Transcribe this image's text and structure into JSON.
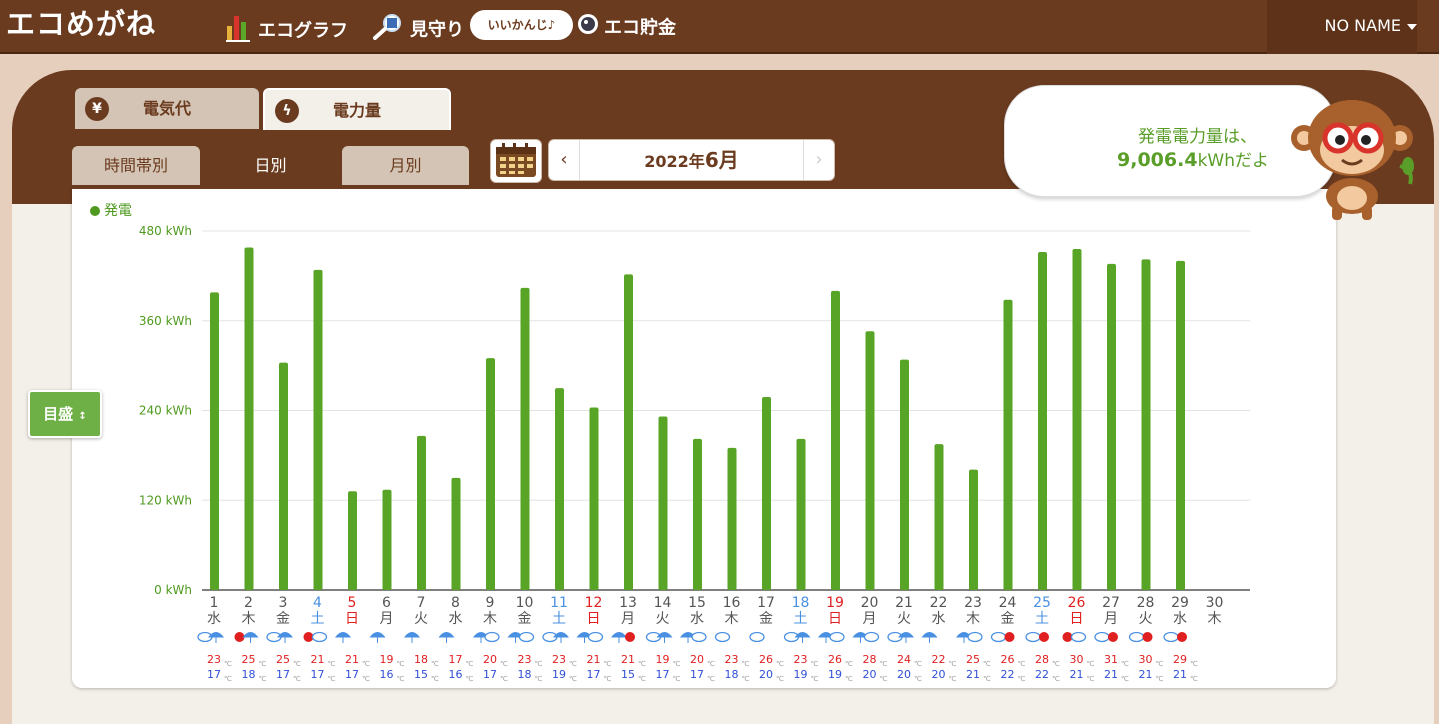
{
  "header": {
    "logo": "エコめがね",
    "nav": [
      {
        "label": "エコグラフ",
        "icon": "bar-chart-icon"
      },
      {
        "label": "見守り",
        "icon": "magnifier-icon"
      },
      {
        "label": "エコ貯金",
        "icon": "coin-icon"
      }
    ],
    "pill": "いいかんじ♪",
    "user": "NO NAME"
  },
  "tabs": {
    "main": [
      {
        "label": "電気代",
        "icon": "yen-icon"
      },
      {
        "label": "電力量",
        "icon": "lightning-icon"
      }
    ],
    "sub": [
      "時間帯別",
      "日別",
      "月別"
    ],
    "active_main": "電力量",
    "active_sub": "日別"
  },
  "date": {
    "year": "2022年",
    "month": "6月"
  },
  "bubble": {
    "line1": "発電電力量は、",
    "value": "9,006.4",
    "unit": "kWhだよ"
  },
  "scale_button": "目盛",
  "colors": {
    "bar": "#58a426",
    "weekday": "#555555",
    "saturday": "#4a90e2",
    "sunday": "#e02020",
    "max_temp": "#e02020",
    "min_temp": "#2f4fd8"
  },
  "chart_data": {
    "type": "bar",
    "legend": "発電",
    "ylim": [
      0,
      480
    ],
    "yticks": [
      "0 kWh",
      "120 kWh",
      "240 kWh",
      "360 kWh",
      "480 kWh"
    ],
    "series": [
      {
        "name": "発電",
        "values": [
          398,
          458,
          304,
          428,
          132,
          134,
          206,
          150,
          310,
          404,
          270,
          244,
          422,
          232,
          202,
          190,
          258,
          202,
          400,
          346,
          308,
          195,
          161,
          388,
          452,
          456,
          436,
          442,
          440,
          null
        ]
      }
    ],
    "days": [
      {
        "d": "1",
        "w": "水",
        "k": "wd",
        "wx": "cloud-rain",
        "hi": "23",
        "lo": "17"
      },
      {
        "d": "2",
        "w": "木",
        "k": "wd",
        "wx": "sun-rain",
        "hi": "25",
        "lo": "18"
      },
      {
        "d": "3",
        "w": "金",
        "k": "wd",
        "wx": "cloud-rain",
        "hi": "25",
        "lo": "17"
      },
      {
        "d": "4",
        "w": "土",
        "k": "sat",
        "wx": "sun-cloud",
        "hi": "21",
        "lo": "17"
      },
      {
        "d": "5",
        "w": "日",
        "k": "sun",
        "wx": "rain",
        "hi": "21",
        "lo": "17"
      },
      {
        "d": "6",
        "w": "月",
        "k": "wd",
        "wx": "rain",
        "hi": "19",
        "lo": "16"
      },
      {
        "d": "7",
        "w": "火",
        "k": "wd",
        "wx": "rain",
        "hi": "18",
        "lo": "15"
      },
      {
        "d": "8",
        "w": "水",
        "k": "wd",
        "wx": "rain",
        "hi": "17",
        "lo": "16"
      },
      {
        "d": "9",
        "w": "木",
        "k": "wd",
        "wx": "rain-cloud",
        "hi": "20",
        "lo": "17"
      },
      {
        "d": "10",
        "w": "金",
        "k": "wd",
        "wx": "rain-cloud",
        "hi": "23",
        "lo": "18"
      },
      {
        "d": "11",
        "w": "土",
        "k": "sat",
        "wx": "cloud-rain",
        "hi": "23",
        "lo": "19"
      },
      {
        "d": "12",
        "w": "日",
        "k": "sun",
        "wx": "rain-cloud",
        "hi": "21",
        "lo": "17"
      },
      {
        "d": "13",
        "w": "月",
        "k": "wd",
        "wx": "rain-sun",
        "hi": "21",
        "lo": "15"
      },
      {
        "d": "14",
        "w": "火",
        "k": "wd",
        "wx": "cloud-rain",
        "hi": "19",
        "lo": "17"
      },
      {
        "d": "15",
        "w": "水",
        "k": "wd",
        "wx": "rain-cloud",
        "hi": "20",
        "lo": "17"
      },
      {
        "d": "16",
        "w": "木",
        "k": "wd",
        "wx": "cloud",
        "hi": "23",
        "lo": "18"
      },
      {
        "d": "17",
        "w": "金",
        "k": "wd",
        "wx": "cloud",
        "hi": "26",
        "lo": "20"
      },
      {
        "d": "18",
        "w": "土",
        "k": "sat",
        "wx": "cloud-rain",
        "hi": "23",
        "lo": "19"
      },
      {
        "d": "19",
        "w": "日",
        "k": "sun",
        "wx": "rain-cloud",
        "hi": "26",
        "lo": "19"
      },
      {
        "d": "20",
        "w": "月",
        "k": "wd",
        "wx": "rain-cloud",
        "hi": "28",
        "lo": "20"
      },
      {
        "d": "21",
        "w": "火",
        "k": "wd",
        "wx": "cloud-rain",
        "hi": "24",
        "lo": "20"
      },
      {
        "d": "22",
        "w": "水",
        "k": "wd",
        "wx": "rain",
        "hi": "22",
        "lo": "20"
      },
      {
        "d": "23",
        "w": "木",
        "k": "wd",
        "wx": "rain-cloud",
        "hi": "25",
        "lo": "21"
      },
      {
        "d": "24",
        "w": "金",
        "k": "wd",
        "wx": "cloud-sun",
        "hi": "26",
        "lo": "22"
      },
      {
        "d": "25",
        "w": "土",
        "k": "sat",
        "wx": "cloud-sun",
        "hi": "28",
        "lo": "22"
      },
      {
        "d": "26",
        "w": "日",
        "k": "sun",
        "wx": "sun-cloud",
        "hi": "30",
        "lo": "21"
      },
      {
        "d": "27",
        "w": "月",
        "k": "wd",
        "wx": "cloud-sun",
        "hi": "31",
        "lo": "21"
      },
      {
        "d": "28",
        "w": "火",
        "k": "wd",
        "wx": "cloud-sun",
        "hi": "30",
        "lo": "21"
      },
      {
        "d": "29",
        "w": "水",
        "k": "wd",
        "wx": "cloud-sun",
        "hi": "29",
        "lo": "21"
      },
      {
        "d": "30",
        "w": "木",
        "k": "wd",
        "wx": "",
        "hi": "",
        "lo": ""
      }
    ],
    "temp_unit": "℃"
  }
}
